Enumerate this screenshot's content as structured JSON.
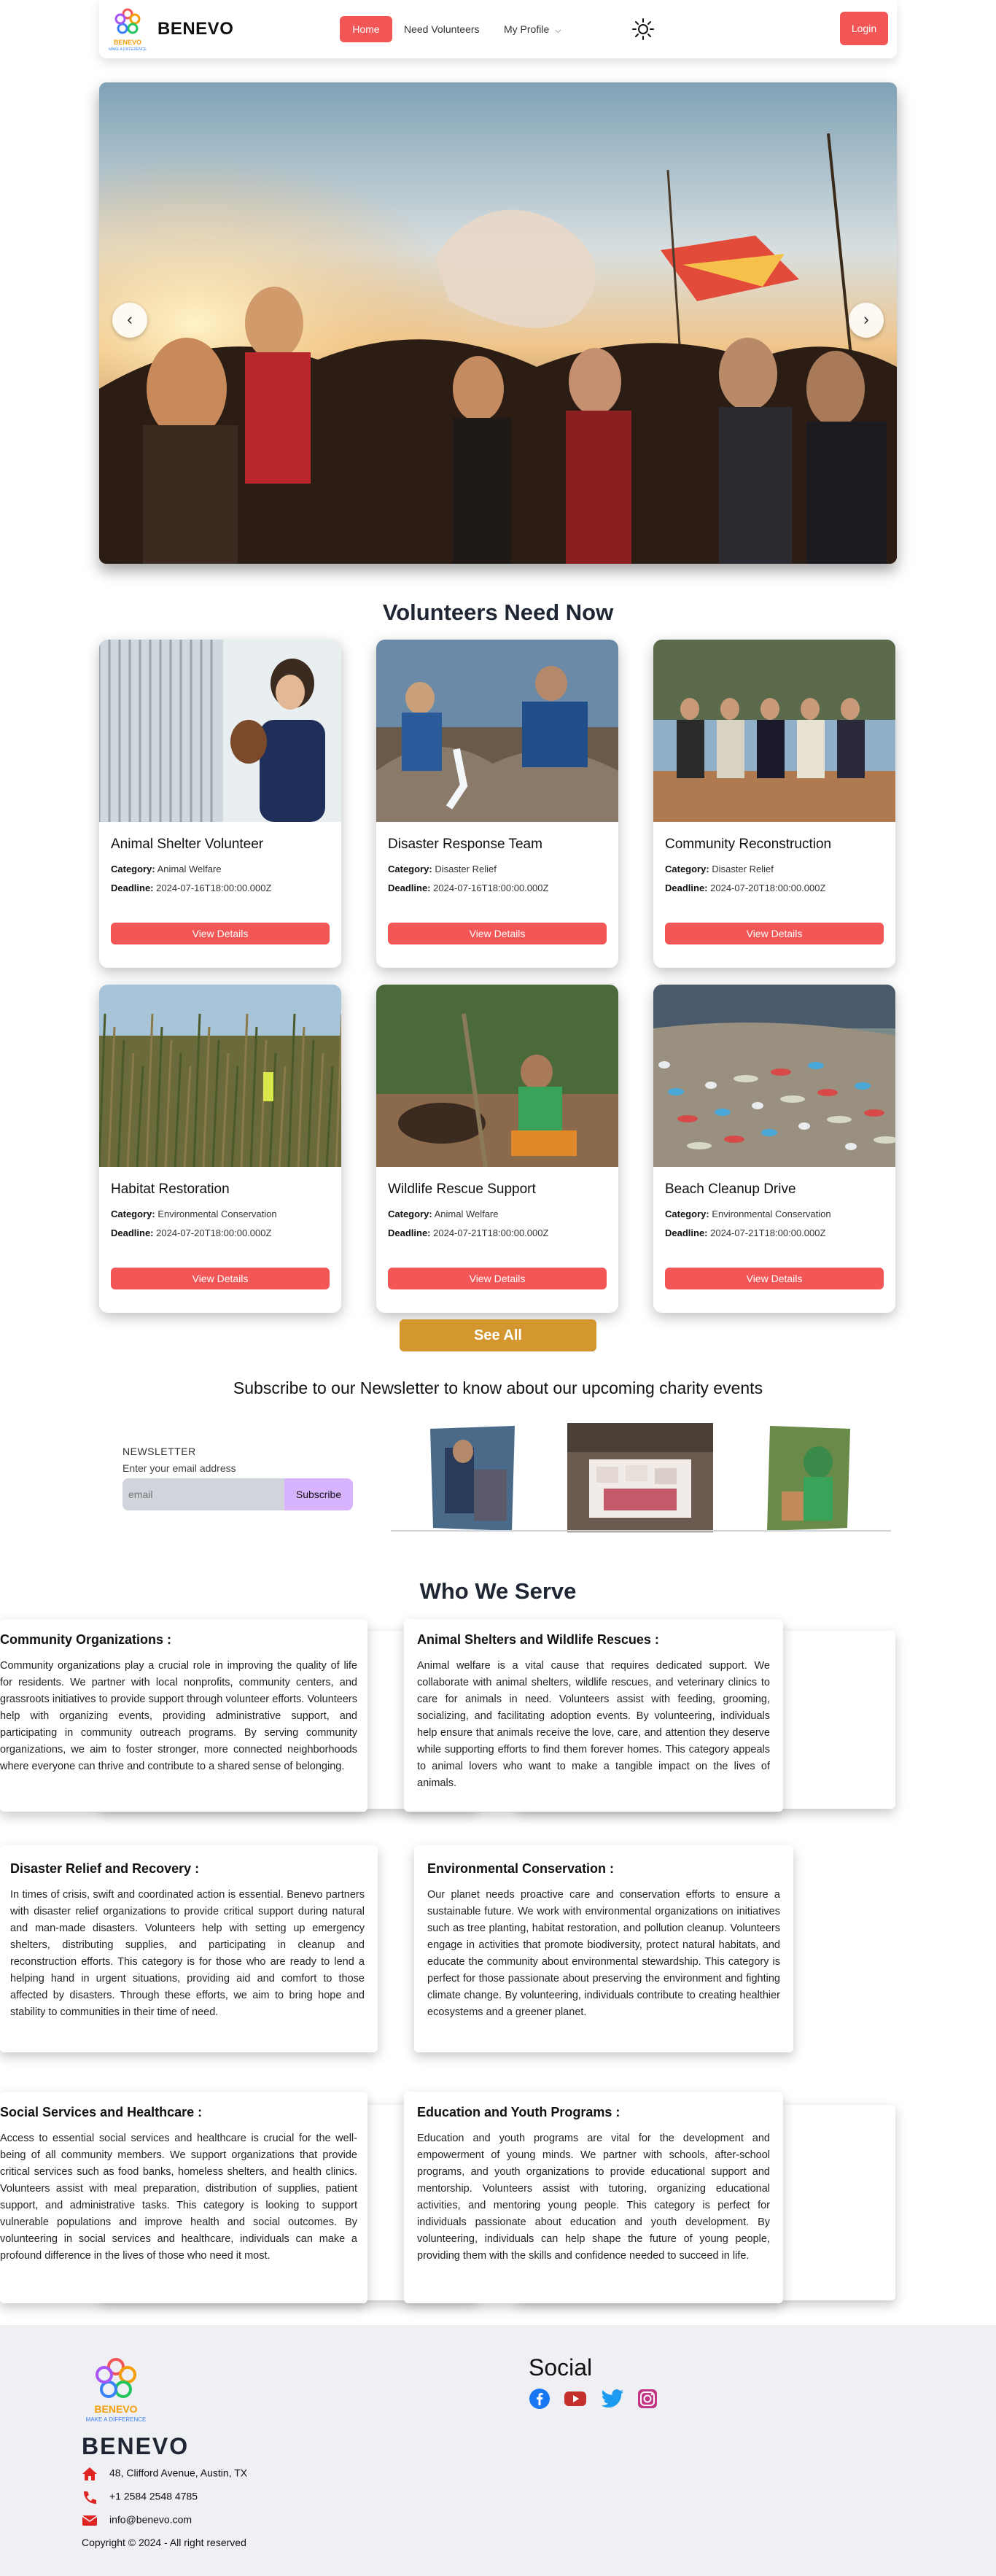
{
  "nav": {
    "brand": "BENEVO",
    "logo_text": "BENEVO",
    "logo_tagline": "MAKE A DIFFERENCE",
    "home": "Home",
    "need_volunteers": "Need Volunteers",
    "my_profile": "My Profile",
    "login": "Login"
  },
  "hero": {
    "prev_icon": "chevron-left-icon",
    "next_icon": "chevron-right-icon"
  },
  "volunteers": {
    "title": "Volunteers Need Now",
    "category_label": "Category:",
    "deadline_label": "Deadline:",
    "button_label": "View Details",
    "cards": [
      {
        "title": "Animal Shelter Volunteer",
        "category": "Animal Welfare",
        "deadline": "2024-07-16T18:00:00.000Z"
      },
      {
        "title": "Disaster Response Team",
        "category": "Disaster Relief",
        "deadline": "2024-07-16T18:00:00.000Z"
      },
      {
        "title": "Community Reconstruction",
        "category": "Disaster Relief",
        "deadline": "2024-07-20T18:00:00.000Z"
      },
      {
        "title": "Habitat Restoration",
        "category": "Environmental Conservation",
        "deadline": "2024-07-20T18:00:00.000Z"
      },
      {
        "title": "Wildlife Rescue Support",
        "category": "Animal Welfare",
        "deadline": "2024-07-21T18:00:00.000Z"
      },
      {
        "title": "Beach Cleanup Drive",
        "category": "Environmental Conservation",
        "deadline": "2024-07-21T18:00:00.000Z"
      }
    ],
    "see_all": "See All"
  },
  "newsletter": {
    "title": "Subscribe to our Newsletter to know about our upcoming charity events",
    "label": "NEWSLETTER",
    "hint": "Enter your email address",
    "placeholder": "email",
    "button": "Subscribe"
  },
  "who": {
    "title": "Who We Serve",
    "items": [
      {
        "title": "Community Organizations :",
        "text": "Community organizations play a crucial role in improving the quality of life for residents. We partner with local nonprofits, community centers, and grassroots initiatives to provide support through volunteer efforts. Volunteers help with organizing events, providing administrative support, and participating in community outreach programs. By serving community organizations, we aim to foster stronger, more connected neighborhoods where everyone can thrive and contribute to a shared sense of belonging."
      },
      {
        "title": "Animal Shelters and Wildlife Rescues :",
        "text": "Animal welfare is a vital cause that requires dedicated support. We collaborate with animal shelters, wildlife rescues, and veterinary clinics to care for animals in need. Volunteers assist with feeding, grooming, socializing, and facilitating adoption events. By volunteering, individuals help ensure that animals receive the love, care, and attention they deserve while supporting efforts to find them forever homes. This category appeals to animal lovers who want to make a tangible impact on the lives of animals."
      },
      {
        "title": "Disaster Relief and Recovery :",
        "text": "In times of crisis, swift and coordinated action is essential. Benevo partners with disaster relief organizations to provide critical support during natural and man-made disasters. Volunteers help with setting up emergency shelters, distributing supplies, and participating in cleanup and reconstruction efforts. This category is for those who are ready to lend a helping hand in urgent situations, providing aid and comfort to those affected by disasters. Through these efforts, we aim to bring hope and stability to communities in their time of need."
      },
      {
        "title": "Environmental Conservation :",
        "text": "Our planet needs proactive care and conservation efforts to ensure a sustainable future. We work with environmental organizations on initiatives such as tree planting, habitat restoration, and pollution cleanup. Volunteers engage in activities that promote biodiversity, protect natural habitats, and educate the community about environmental stewardship. This category is perfect for those passionate about preserving the environment and fighting climate change. By volunteering, individuals contribute to creating healthier ecosystems and a greener planet."
      },
      {
        "title": "Social Services and Healthcare :",
        "text": "Access to essential social services and healthcare is crucial for the well-being of all community members. We support organizations that provide critical services such as food banks, homeless shelters, and health clinics. Volunteers assist with meal preparation, distribution of supplies, patient support, and administrative tasks. This category is looking to support vulnerable populations and improve health and social outcomes. By volunteering in social services and healthcare, individuals can make a profound difference in the lives of those who need it most."
      },
      {
        "title": "Education and Youth Programs :",
        "text": "Education and youth programs are vital for the development and empowerment of young minds. We partner with schools, after-school programs, and youth organizations to provide educational support and mentorship. Volunteers assist with tutoring, organizing educational activities, and mentoring young people. This category is perfect for individuals passionate about education and youth development. By volunteering, individuals can help shape the future of young people, providing them with the skills and confidence needed to succeed in life."
      }
    ]
  },
  "footer": {
    "brand": "BENEVO",
    "logo_text": "BENEVO",
    "logo_tagline": "MAKE A DIFFERENCE",
    "address": "48, Clifford Avenue, Austin, TX",
    "phone": "+1 2584 2548 4785",
    "email": "info@benevo.com",
    "copyright": "Copyright © 2024 - All right reserved",
    "social_title": "Social",
    "social_icons": [
      "facebook-icon",
      "youtube-icon",
      "twitter-icon",
      "instagram-icon"
    ]
  },
  "colors": {
    "accent": "#f25656",
    "see_all": "#d4962e",
    "subscribe": "#d8b4fe",
    "footer_bg": "#eef0f4"
  }
}
